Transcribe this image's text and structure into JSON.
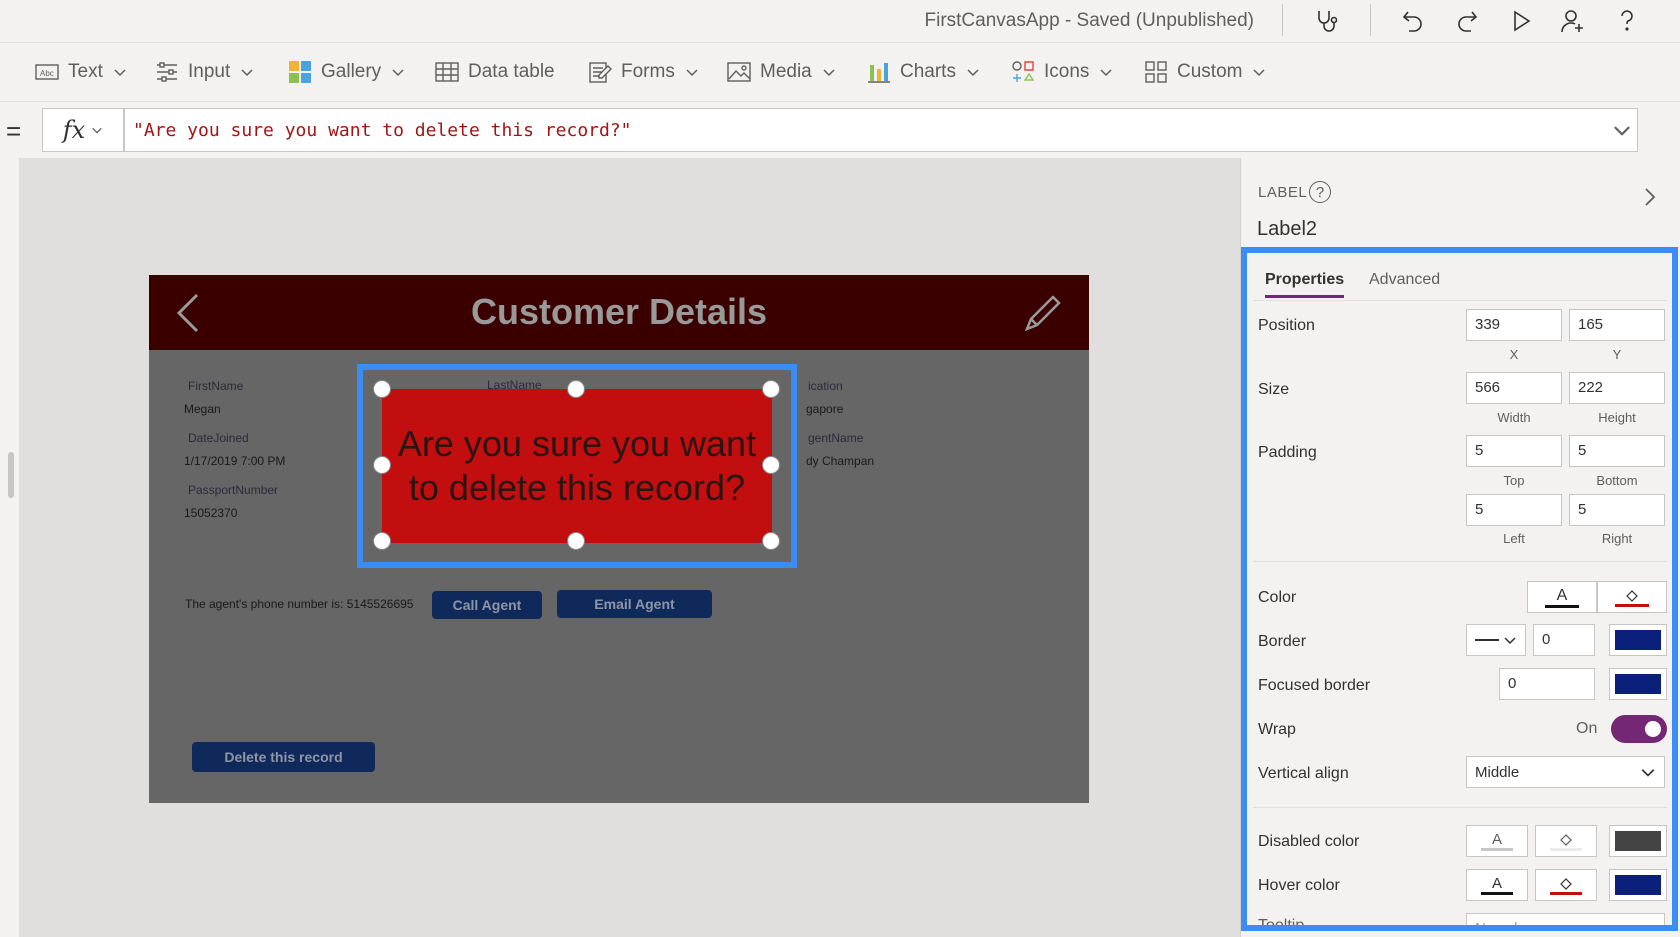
{
  "titlebar": {
    "app_title": "FirstCanvasApp - Saved (Unpublished)",
    "icons": [
      "stethoscope-icon",
      "undo-icon",
      "redo-icon",
      "play-icon",
      "share-user-icon",
      "help-icon"
    ]
  },
  "ribbon": {
    "items": [
      {
        "label": "Text",
        "icon": "text-label-icon",
        "has_dropdown": true
      },
      {
        "label": "Input",
        "icon": "sliders-icon",
        "has_dropdown": true
      },
      {
        "label": "Gallery",
        "icon": "gallery-icon",
        "has_dropdown": true
      },
      {
        "label": "Data table",
        "icon": "table-icon",
        "has_dropdown": false
      },
      {
        "label": "Forms",
        "icon": "form-icon",
        "has_dropdown": true
      },
      {
        "label": "Media",
        "icon": "image-icon",
        "has_dropdown": true
      },
      {
        "label": "Charts",
        "icon": "bar-chart-icon",
        "has_dropdown": true
      },
      {
        "label": "Icons",
        "icon": "icons-icon",
        "has_dropdown": true
      },
      {
        "label": "Custom",
        "icon": "component-icon",
        "has_dropdown": true
      }
    ]
  },
  "formula_bar": {
    "equals": "=",
    "fx": "fx",
    "formula": "\"Are you sure you want to delete this record?\""
  },
  "screen": {
    "title": "Customer Details",
    "fields": {
      "firstname_label": "FirstName",
      "firstname_value": "Megan",
      "datejoined_label": "DateJoined",
      "datejoined_value": "1/17/2019 7:00 PM",
      "passport_label": "PassportNumber",
      "passport_value": "15052370",
      "lastname_label": "LastName",
      "location_label": "ication",
      "location_value": "gapore",
      "agentname_label": "gentName",
      "agentname_value": "dy Champan"
    },
    "phone_text": "The agent's phone number is:  5145526695",
    "call_agent": "Call Agent",
    "email_agent": "Email Agent",
    "delete_record": "Delete this record",
    "selected_label_text": "Are you sure you want to delete this record?",
    "colors": {
      "header": "#3a0000",
      "label_fill": "#c20e0e",
      "selection": "#3b8cf5"
    }
  },
  "pane": {
    "control_type": "LABEL",
    "control_name": "Label2",
    "tabs": {
      "properties": "Properties",
      "advanced": "Advanced"
    },
    "position": {
      "label": "Position",
      "x": "339",
      "y": "165",
      "x_cap": "X",
      "y_cap": "Y"
    },
    "size": {
      "label": "Size",
      "width": "566",
      "height": "222",
      "width_cap": "Width",
      "height_cap": "Height"
    },
    "padding": {
      "label": "Padding",
      "top": "5",
      "bottom": "5",
      "left": "5",
      "right": "5",
      "top_cap": "Top",
      "bottom_cap": "Bottom",
      "left_cap": "Left",
      "right_cap": "Right"
    },
    "color": {
      "label": "Color",
      "text_glyph": "A"
    },
    "border": {
      "label": "Border",
      "value": "0",
      "color": "#0a1f7a"
    },
    "focused_border": {
      "label": "Focused border",
      "value": "0",
      "color": "#0a1f7a"
    },
    "wrap": {
      "label": "Wrap",
      "state": "On"
    },
    "vertical_align": {
      "label": "Vertical align",
      "value": "Middle"
    },
    "disabled_color": {
      "label": "Disabled color",
      "text_glyph": "A",
      "fill": "#444444"
    },
    "hover_color": {
      "label": "Hover color",
      "text_glyph": "A",
      "fill": "#0a1f7a"
    },
    "tooltip": {
      "label": "Tooltip",
      "placeholder": "No value"
    }
  }
}
